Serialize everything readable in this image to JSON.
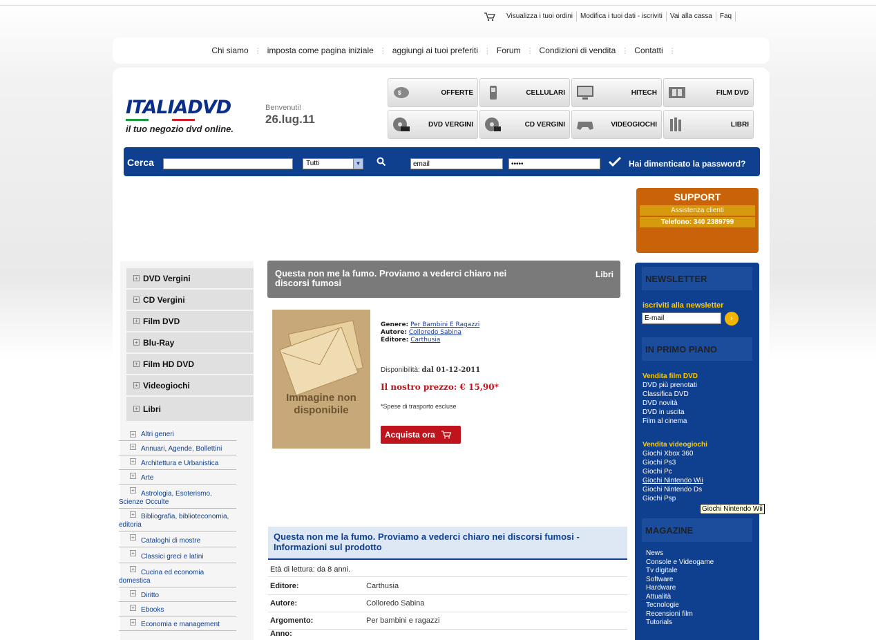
{
  "toplinks": [
    "Visualizza i tuoi ordini",
    "Modifica i tuoi dati - iscriviti",
    "Vai alla cassa",
    "Faq"
  ],
  "nav": [
    "Chi siamo",
    "imposta come pagina iniziale",
    "aggiungi ai tuoi preferiti",
    "Forum",
    "Condizioni di vendita",
    "Contatti"
  ],
  "logo": {
    "brand": "ITALIADVD",
    "tagline": "il tuo negozio dvd online."
  },
  "welcome": {
    "greeting": "Benvenuti!",
    "date": "26.lug.11"
  },
  "categories": [
    "OFFERTE",
    "CELLULARI",
    "HITECH",
    "FILM DVD",
    "DVD VERGINI",
    "CD VERGINI",
    "VIDEOGIOCHI",
    "LIBRI"
  ],
  "search": {
    "label": "Cerca",
    "select_value": "Tutti",
    "email_value": "email",
    "password_value": "•••••",
    "forgot": "Hai dimenticato la password?"
  },
  "support": {
    "title": "SUPPORT",
    "subtitle": "Assistenza clienti",
    "phone": "Telefono: 340 2389799"
  },
  "left_menu": [
    "DVD Vergini",
    "CD Vergini",
    "Film DVD",
    "Blu-Ray",
    "Film HD DVD",
    "Videogiochi",
    "Libri"
  ],
  "sub_menu": [
    "Altri generi",
    "Annuari, Agende, Bollettini",
    "Architettura e Urbanistica",
    "Arte",
    "Astrologia, Esoterismo, Scienze Occulte",
    "Bibliografia, biblioteconomia, editoria",
    "Cataloghi di mostre",
    "Classici greci e latini",
    "Cucina ed economia domestica",
    "Diritto",
    "Ebooks",
    "Economia e management"
  ],
  "product": {
    "title": "Questa non me la fumo. Proviamo a vederci chiaro nei discorsi fumosi",
    "category": "Libri",
    "noimage": "Immagine non disponibile",
    "genere_label": "Genere:",
    "genere": "Per Bambini E Ragazzi",
    "autore_label": "Autore:",
    "autore": "Colloredo Sabina",
    "editore_label": "Editore:",
    "editore": "Carthusia",
    "avail_label": "Disponibilità:",
    "avail": "dal 01-12-2011",
    "price": "Il nostro prezzo: € 15,90*",
    "shipping": "*Spese di trasporto escluse",
    "buy": "Acquista ora"
  },
  "info": {
    "heading": "Questa non me la fumo. Proviamo a vederci chiaro nei discorsi fumosi - Informazioni sul prodotto",
    "eta": "Età di lettura: da 8 anni.",
    "rows": [
      {
        "k": "Editore:",
        "v": "Carthusia"
      },
      {
        "k": "Autore:",
        "v": "Colloredo Sabina"
      },
      {
        "k": "Argomento:",
        "v": "Per bambini e ragazzi"
      },
      {
        "k": "Anno:",
        "v": ""
      }
    ]
  },
  "newsletter": {
    "title": "NEWSLETTER",
    "label": "iscriviti alla newsletter",
    "placeholder": "E-mail"
  },
  "primo_piano": {
    "title": "IN PRIMO PIANO",
    "film_head": "Vendita film DVD",
    "film": [
      "DVD più prenotati",
      "Classifica DVD",
      "DVD novità",
      "DVD in uscita",
      "Film al cinema"
    ],
    "games_head": "Vendita videogiochi",
    "games": [
      "Giochi Xbox 360",
      "Giochi Ps3",
      "Giochi Pc",
      "Giochi Nintendo Wii",
      "Giochi Nintendo Ds",
      "Giochi Psp"
    ]
  },
  "tooltip": "Giochi Nintendo Wii",
  "magazine": {
    "title": "MAGAZINE",
    "items": [
      "News",
      "Console e Videogame",
      "Tv digitale",
      "Software",
      "Hardware",
      "Attualità",
      "Tecnologie",
      "Recensioni film",
      "Tutorials"
    ]
  },
  "colors": {
    "blue": "#0f3f8f",
    "red": "#c0141c",
    "orange": "#c8630a",
    "yellow": "#ffcc00"
  }
}
